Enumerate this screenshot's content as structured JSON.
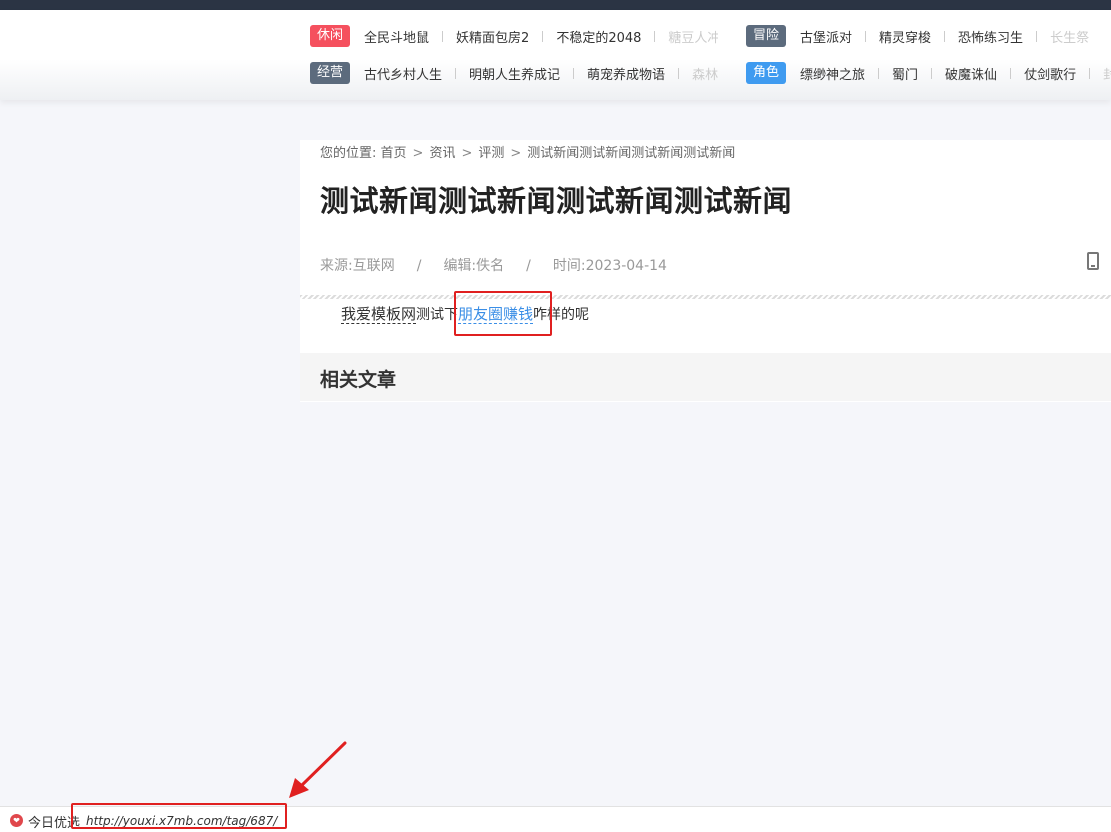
{
  "nav": {
    "row1": [
      {
        "badge": "休闲",
        "badge_color": "#f5505e",
        "items": [
          "全民斗地鼠",
          "妖精面包房2",
          "不稳定的2048",
          "糖豆人冲"
        ]
      },
      {
        "badge": "冒险",
        "badge_color": "#5c6b7d",
        "items": [
          "古堡派对",
          "精灵穿梭",
          "恐怖练习生",
          "长生祭"
        ]
      }
    ],
    "row2": [
      {
        "badge": "经营",
        "badge_color": "#5c6b7d",
        "items": [
          "古代乡村人生",
          "明朝人生养成记",
          "萌宠养成物语",
          "森林"
        ]
      },
      {
        "badge": "角色",
        "badge_color": "#3f9bf0",
        "items": [
          "缥缈神之旅",
          "蜀门",
          "破魔诛仙",
          "仗剑歌行",
          "封"
        ]
      }
    ]
  },
  "breadcrumb": {
    "prefix": "您的位置:",
    "items": [
      "首页",
      "资讯",
      "评测",
      "测试新闻测试新闻测试新闻测试新闻"
    ],
    "sep": ">"
  },
  "article": {
    "title": "测试新闻测试新闻测试新闻测试新闻",
    "source": "来源:互联网",
    "editor": "编辑:佚名",
    "time": "时间:2023-04-14",
    "meta_sep": "/",
    "body": {
      "keyword1": "我爱模板网",
      "text1": "测试下",
      "keyword_link": "朋友圈赚钱",
      "text2": "咋样的呢"
    }
  },
  "related": {
    "title": "相关文章"
  },
  "status": {
    "label": "今日优选",
    "url": "http://youxi.x7mb.com/tag/687/"
  },
  "colors": {
    "highlight": "#e02020",
    "link": "#3a8ee6"
  }
}
